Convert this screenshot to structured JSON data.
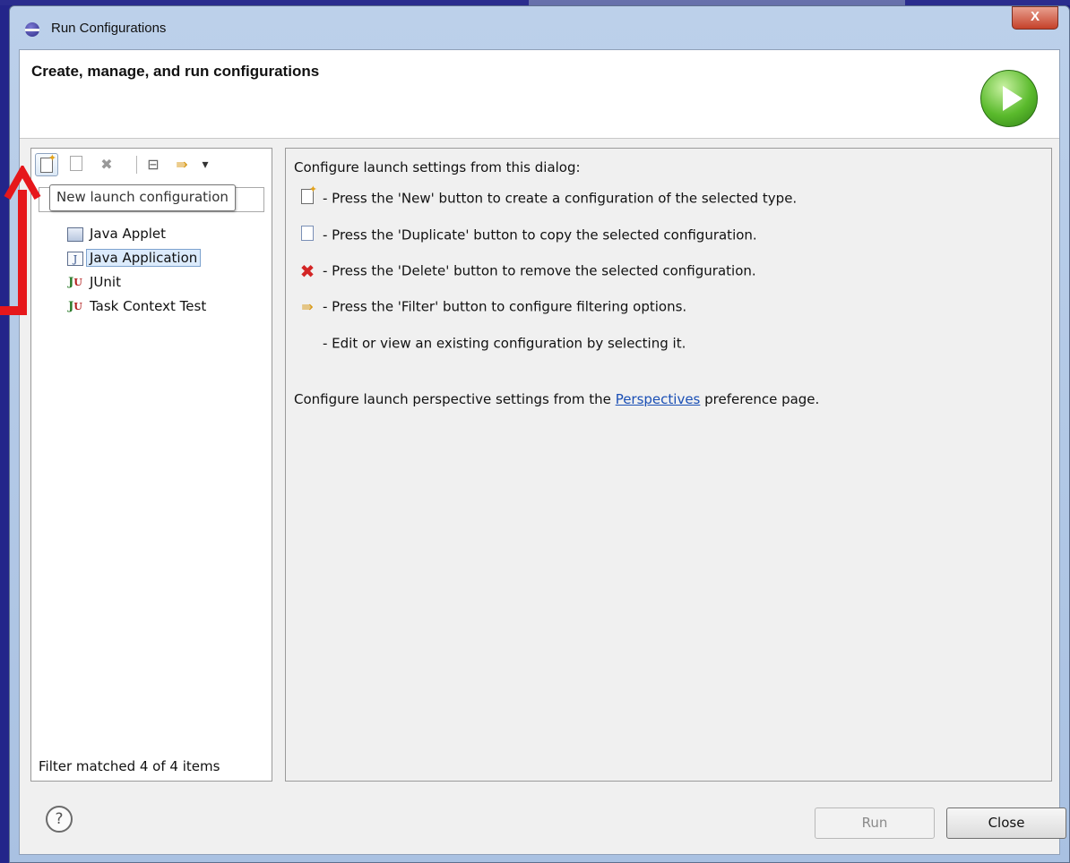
{
  "window": {
    "title": "Run Configurations",
    "close_glyph": "X"
  },
  "header": {
    "title": "Create, manage, and run configurations",
    "icon": "run-icon"
  },
  "toolbar": {
    "new_icon": "new-config-icon",
    "duplicate_icon": "duplicate-icon",
    "delete_icon": "delete-icon",
    "collapse_icon": "collapse-all-icon",
    "filter_icon": "filter-icon",
    "dropdown_icon": "chevron-down-icon",
    "delete_glyph": "✖",
    "collapse_glyph": "⊟",
    "filter_glyph": "⇛",
    "dropdown_glyph": "▾"
  },
  "tooltip": {
    "text": "New launch configuration"
  },
  "tree": {
    "items": [
      {
        "label": "Java Applet",
        "icon": "java-applet-icon",
        "selected": false
      },
      {
        "label": "Java Application",
        "icon": "java-application-icon",
        "selected": true
      },
      {
        "label": "JUnit",
        "icon": "junit-icon",
        "selected": false
      },
      {
        "label": "Task Context Test",
        "icon": "task-context-test-icon",
        "selected": false
      }
    ]
  },
  "filter_status": "Filter matched 4 of 4 items",
  "info": {
    "title": "Configure launch settings from this dialog:",
    "lines": [
      {
        "icon": "new-config-icon",
        "text": "- Press the 'New' button to create a configuration of the selected type."
      },
      {
        "icon": "duplicate-icon",
        "text": "- Press the 'Duplicate' button to copy the selected configuration."
      },
      {
        "icon": "delete-icon",
        "text": "- Press the 'Delete' button to remove the selected configuration."
      },
      {
        "icon": "filter-icon",
        "text": "- Press the 'Filter' button to configure filtering options."
      },
      {
        "icon": "",
        "text": "- Edit or view an existing configuration by selecting it."
      }
    ],
    "perspective_prefix": "Configure launch perspective settings from the",
    "perspective_link": "Perspectives",
    "perspective_suffix": "preference page."
  },
  "buttons": {
    "help": "?",
    "run": "Run",
    "close": "Close"
  },
  "colors": {
    "annotation_arrow": "#e6171b",
    "selection": "#dcebfc",
    "link": "#1a4fb5"
  }
}
